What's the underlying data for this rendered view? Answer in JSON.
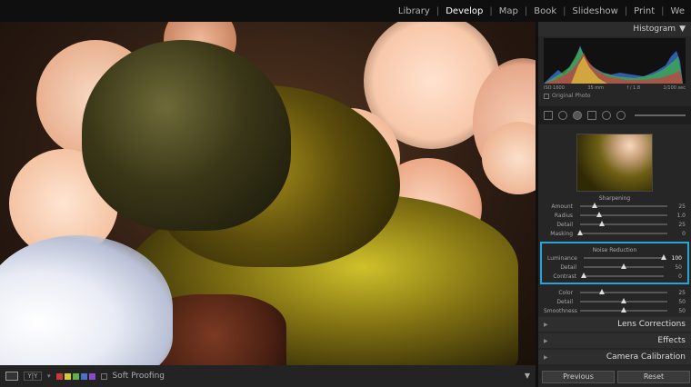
{
  "modules": [
    "Library",
    "Develop",
    "Map",
    "Book",
    "Slideshow",
    "Print",
    "We"
  ],
  "active_module": "Develop",
  "histogram": {
    "title": "Histogram",
    "iso": "ISO 1600",
    "focal": "35 mm",
    "aperture": "f / 1.8",
    "shutter": "1/100 sec",
    "original_photo_label": "Original Photo"
  },
  "sharpening": {
    "title": "Sharpening",
    "sliders": [
      {
        "label": "Amount",
        "value": "25",
        "pos": 0.17
      },
      {
        "label": "Radius",
        "value": "1.0",
        "pos": 0.22
      },
      {
        "label": "Detail",
        "value": "25",
        "pos": 0.25
      },
      {
        "label": "Masking",
        "value": "0",
        "pos": 0.0
      }
    ]
  },
  "noise_reduction": {
    "title": "Noise Reduction",
    "luminance": [
      {
        "label": "Luminance",
        "value": "100",
        "pos": 1.0
      },
      {
        "label": "Detail",
        "value": "50",
        "pos": 0.5
      },
      {
        "label": "Contrast",
        "value": "0",
        "pos": 0.0
      }
    ],
    "color": [
      {
        "label": "Color",
        "value": "25",
        "pos": 0.25
      },
      {
        "label": "Detail",
        "value": "50",
        "pos": 0.5
      },
      {
        "label": "Smoothness",
        "value": "50",
        "pos": 0.5
      }
    ]
  },
  "collapsed_panels": [
    "Lens Corrections",
    "Effects",
    "Camera Calibration"
  ],
  "buttons": {
    "previous": "Previous",
    "reset": "Reset"
  },
  "toolbar": {
    "soft_proofing": "Soft Proofing",
    "compare_label": "Y|Y",
    "swatch_colors": [
      "#c83a3a",
      "#d6c63a",
      "#5fb14a",
      "#4a73c8",
      "#8a4ac8"
    ]
  },
  "colors": {
    "highlight": "#2aa3d8"
  }
}
